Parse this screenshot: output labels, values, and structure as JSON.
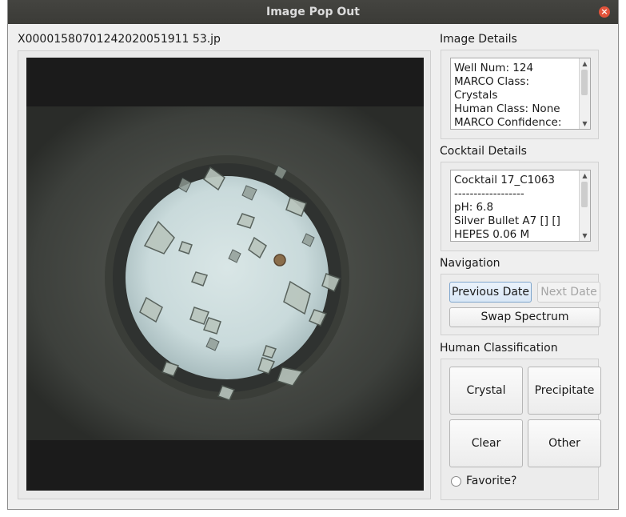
{
  "window": {
    "title": "Image Pop Out"
  },
  "image": {
    "filename": "X00001580701242020051911 53.jp"
  },
  "image_details": {
    "label": "Image Details",
    "lines": [
      "Well Num: 124",
      "MARCO Class:",
      "Crystals",
      "Human Class: None",
      "MARCO Confidence:"
    ]
  },
  "cocktail_details": {
    "label": "Cocktail Details",
    "lines": [
      "Cocktail 17_C1063",
      "------------------",
      "pH: 6.8",
      "Silver Bullet A7 [] []",
      "HEPES 0.06 M"
    ]
  },
  "navigation": {
    "label": "Navigation",
    "previous": "Previous Date",
    "next": "Next Date",
    "swap": "Swap Spectrum"
  },
  "human_classification": {
    "label": "Human Classification",
    "crystal": "Crystal",
    "precipitate": "Precipitate",
    "clear": "Clear",
    "other": "Other",
    "favorite": "Favorite?"
  },
  "colors": {
    "titlebar": "#3d3d39",
    "close": "#e2533b",
    "window_bg": "#efefef"
  }
}
